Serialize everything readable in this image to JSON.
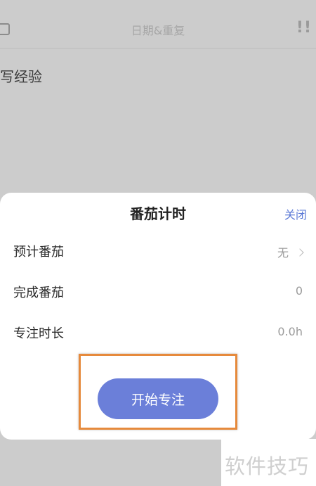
{
  "background": {
    "date_repeat": "日期&重复",
    "priority": "!!",
    "task_title": "写经验"
  },
  "popup": {
    "title": "番茄计时",
    "close_label": "关闭",
    "rows": [
      {
        "label": "预计番茄",
        "value": "无"
      },
      {
        "label": "完成番茄",
        "value": "0"
      },
      {
        "label": "专注时长",
        "value": "0.0h"
      }
    ],
    "start_button": "开始专注"
  },
  "watermark": "软件技巧",
  "colors": {
    "accent": "#5b79d6",
    "button": "#6b7fd9",
    "highlight": "#e68a3c"
  }
}
